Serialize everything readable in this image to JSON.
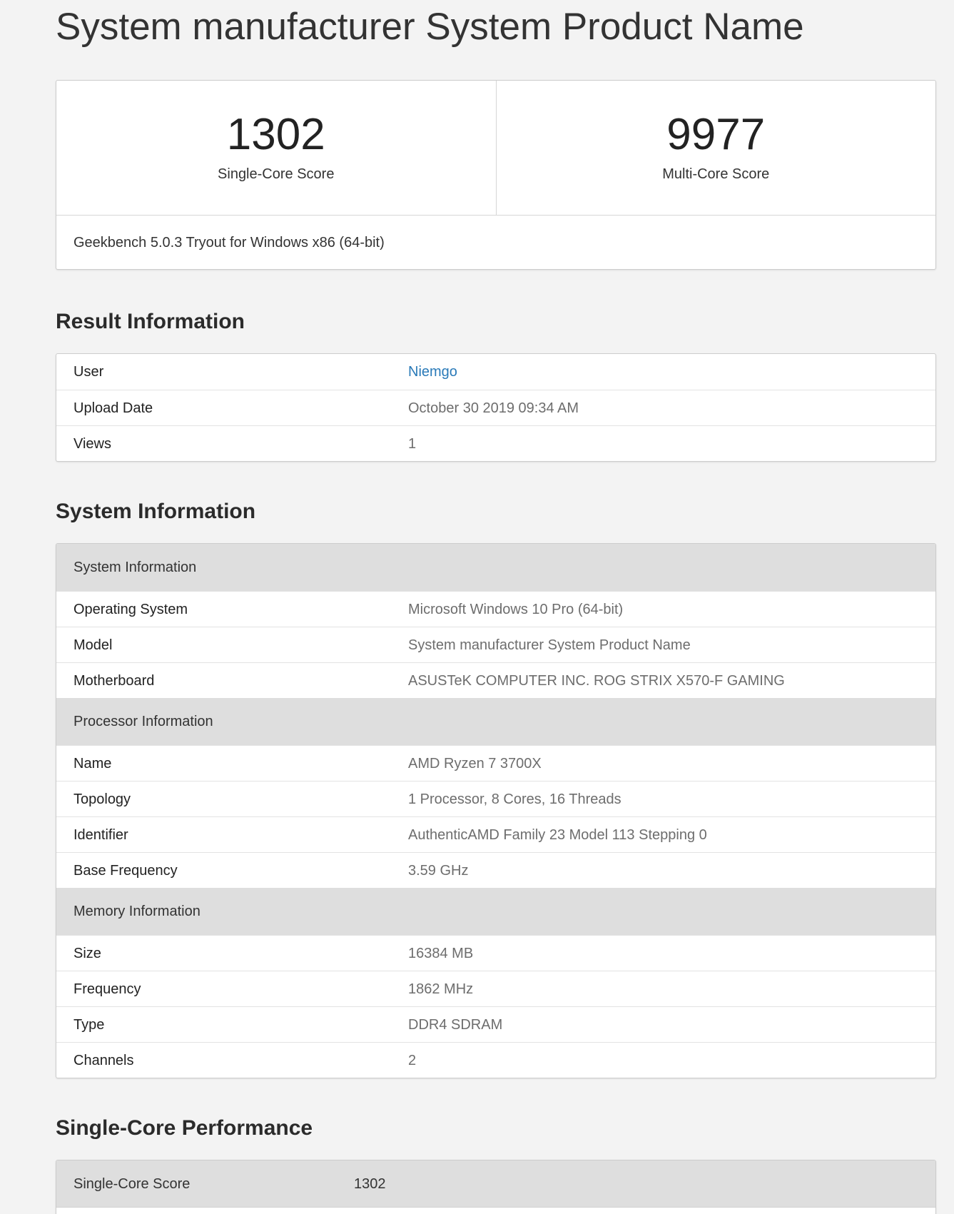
{
  "page_title": "System manufacturer System Product Name",
  "scores": {
    "single_value": "1302",
    "single_label": "Single-Core Score",
    "multi_value": "9977",
    "multi_label": "Multi-Core Score",
    "version": "Geekbench 5.0.3 Tryout for Windows x86 (64-bit)"
  },
  "result_info": {
    "heading": "Result Information",
    "rows": [
      {
        "key": "User",
        "value": "Niemgo"
      },
      {
        "key": "Upload Date",
        "value": "October 30 2019 09:34 AM"
      },
      {
        "key": "Views",
        "value": "1"
      }
    ]
  },
  "system_info": {
    "heading": "System Information",
    "groups": [
      {
        "title": "System Information",
        "rows": [
          {
            "key": "Operating System",
            "value": "Microsoft Windows 10 Pro (64-bit)"
          },
          {
            "key": "Model",
            "value": "System manufacturer System Product Name"
          },
          {
            "key": "Motherboard",
            "value": "ASUSTeK COMPUTER INC. ROG STRIX X570-F GAMING"
          }
        ]
      },
      {
        "title": "Processor Information",
        "rows": [
          {
            "key": "Name",
            "value": "AMD Ryzen 7 3700X"
          },
          {
            "key": "Topology",
            "value": "1 Processor, 8 Cores, 16 Threads"
          },
          {
            "key": "Identifier",
            "value": "AuthenticAMD Family 23 Model 113 Stepping 0"
          },
          {
            "key": "Base Frequency",
            "value": "3.59 GHz"
          }
        ]
      },
      {
        "title": "Memory Information",
        "rows": [
          {
            "key": "Size",
            "value": "16384 MB"
          },
          {
            "key": "Frequency",
            "value": "1862 MHz"
          },
          {
            "key": "Type",
            "value": "DDR4 SDRAM"
          },
          {
            "key": "Channels",
            "value": "2"
          }
        ]
      }
    ]
  },
  "single_core": {
    "heading": "Single-Core Performance",
    "score_label": "Single-Core Score",
    "score_value": "1302"
  }
}
